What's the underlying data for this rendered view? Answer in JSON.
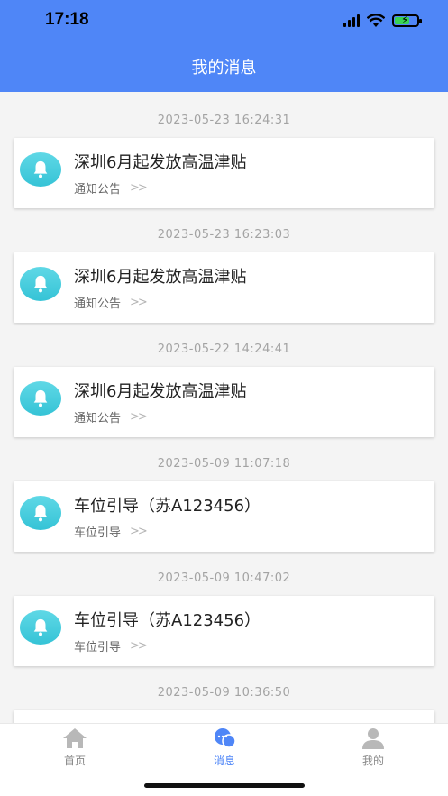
{
  "status_bar": {
    "time": "17:18"
  },
  "header": {
    "title": "我的消息"
  },
  "messages": [
    {
      "timestamp": "2023-05-23   16:24:31",
      "title": "深圳6月起发放高温津贴",
      "category": "通知公告",
      "more": ">>"
    },
    {
      "timestamp": "2023-05-23   16:23:03",
      "title": "深圳6月起发放高温津贴",
      "category": "通知公告",
      "more": ">>"
    },
    {
      "timestamp": "2023-05-22   14:24:41",
      "title": "深圳6月起发放高温津贴",
      "category": "通知公告",
      "more": ">>"
    },
    {
      "timestamp": "2023-05-09   11:07:18",
      "title": "车位引导（苏A123456）",
      "category": "车位引导",
      "more": ">>"
    },
    {
      "timestamp": "2023-05-09   10:47:02",
      "title": "车位引导（苏A123456）",
      "category": "车位引导",
      "more": ">>"
    },
    {
      "timestamp": "2023-05-09   10:36:50",
      "title": "",
      "category": "",
      "more": ""
    }
  ],
  "tabbar": {
    "home": "首页",
    "messages": "消息",
    "mine": "我的"
  },
  "colors": {
    "primary": "#4f86f7",
    "bell": "#35c3d6"
  },
  "icons": {
    "bell": "bell-icon",
    "home": "home-icon",
    "chat": "chat-icon",
    "user": "user-icon"
  }
}
